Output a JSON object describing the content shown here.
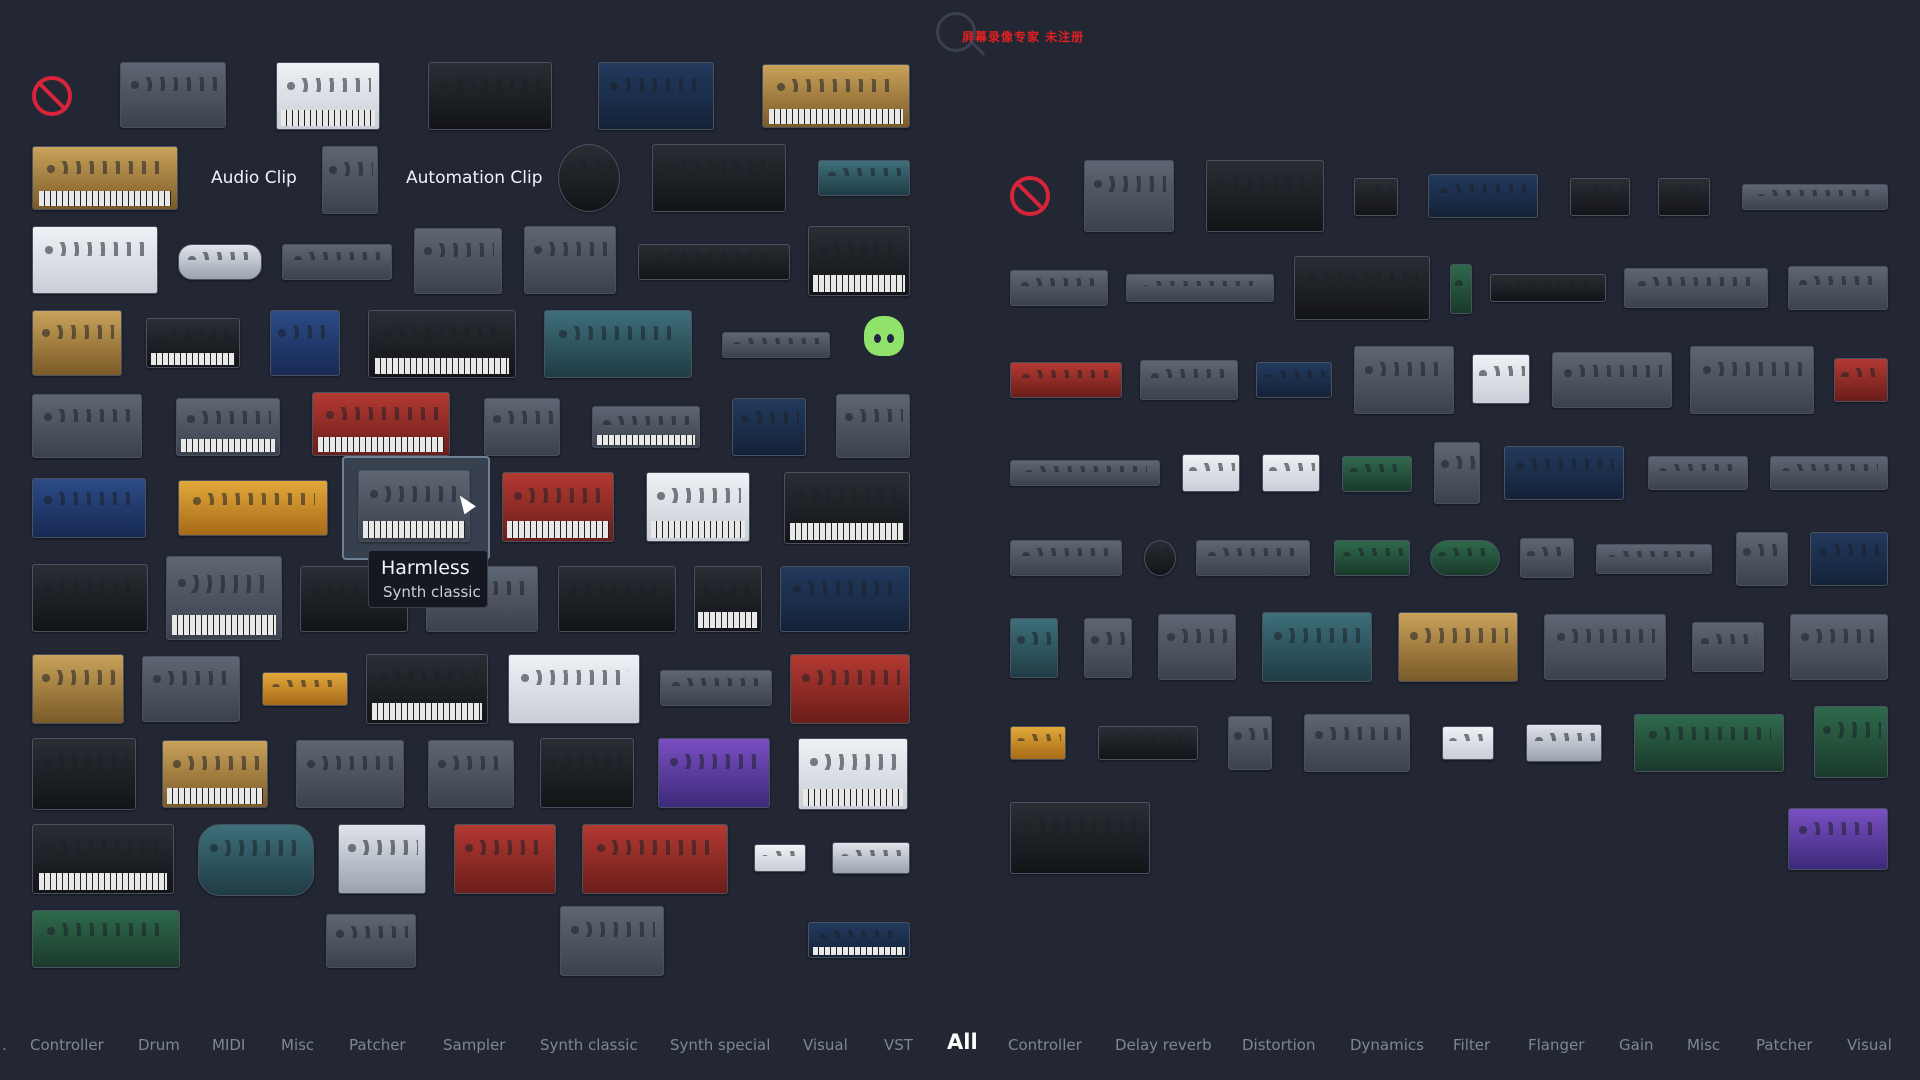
{
  "watermark": {
    "text": "屏幕录像专家 未注册"
  },
  "generator_panel": {
    "clips": [
      {
        "label": "Audio Clip"
      },
      {
        "label": "Automation Clip"
      }
    ],
    "hovered_plugin": {
      "name": "Harmless",
      "category": "Synth classic"
    }
  },
  "category_bar": {
    "leading": ".",
    "generator_categories": [
      "Controller",
      "Drum",
      "MIDI",
      "Misc",
      "Patcher",
      "Sampler",
      "Synth classic",
      "Synth special",
      "Visual",
      "VST"
    ],
    "all_label": "All",
    "effect_categories": [
      "Controller",
      "Delay reverb",
      "Distortion",
      "Dynamics",
      "Filter",
      "Flanger",
      "Gain",
      "Misc",
      "Patcher",
      "Visual"
    ]
  },
  "icons": {
    "none_slot_left": "no-entry-icon",
    "none_slot_right": "no-entry-icon",
    "mascot": "green-hair-character-icon"
  },
  "colors": {
    "background": "#222733",
    "active_category": "#ffffff",
    "inactive_category": "#7f8794",
    "no_entry": "#d8243a",
    "watermark": "#e12020"
  }
}
